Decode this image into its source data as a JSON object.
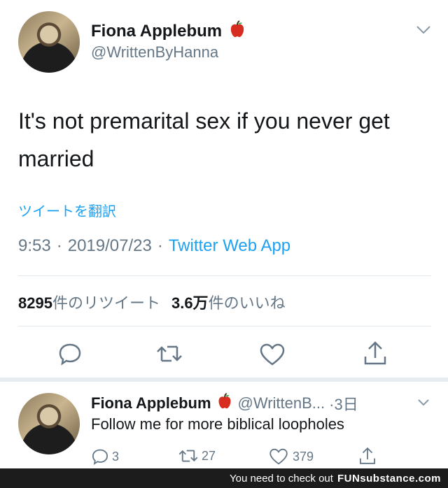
{
  "tweet": {
    "author_name": "Fiona Applebum",
    "author_emoji": "🍎",
    "handle": "@WrittenByHanna",
    "text": "It's not premarital sex if you never get married",
    "translate_label": "ツイートを翻訳",
    "time": "9:53",
    "date": "2019/07/23",
    "separator": "·",
    "source": "Twitter Web App",
    "retweet_count": "8295",
    "retweet_label": "件のリツイート",
    "like_count": "3.6万",
    "like_label": "件のいいね"
  },
  "reply": {
    "author_name": "Fiona Applebum",
    "author_emoji": "🍎",
    "handle": "@WrittenB...",
    "time_ago": "·3日",
    "text": "Follow me for more biblical loopholes",
    "reply_count": "3",
    "retweet_count": "27",
    "like_count": "379"
  },
  "footer": {
    "text": "You need to check out",
    "brand": "FUNsubstance.com"
  },
  "colors": {
    "accent": "#1da1f2",
    "muted": "#657786",
    "divider": "#e1e8ed",
    "apple": "#d62d20"
  },
  "icons": [
    "chevron-down-icon",
    "reply-icon",
    "retweet-icon",
    "like-icon",
    "share-icon",
    "apple-emoji-icon"
  ]
}
